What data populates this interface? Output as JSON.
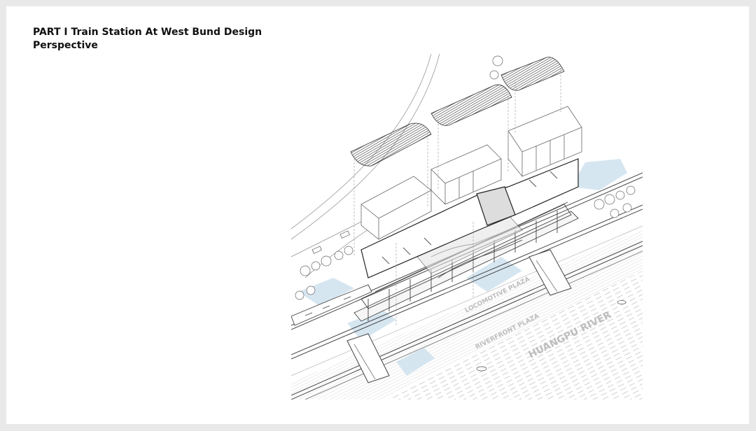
{
  "title": {
    "line1": "PART I Train Station At West Bund Design",
    "line2": "Perspective"
  },
  "drawing": {
    "labels": {
      "upper_plaza": "LOCOMOTIVE PLAZA",
      "lower_plaza": "RIVERFRONT PLAZA",
      "river": "HUANGPU RIVER"
    }
  },
  "colors": {
    "background": "#e9e9e9",
    "slide": "#ffffff",
    "line": "#555555",
    "blue": "#cfe2ef"
  }
}
